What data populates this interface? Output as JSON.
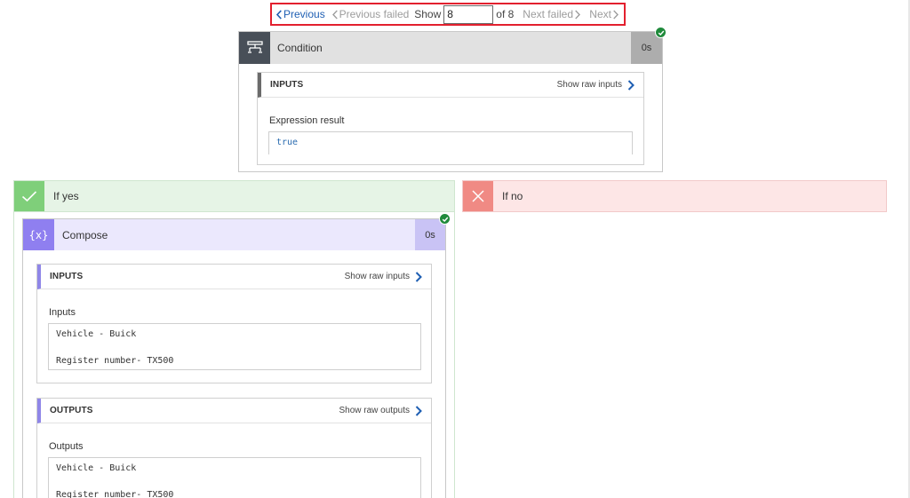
{
  "pager": {
    "previous_label": "Previous",
    "previous_failed_label": "Previous failed",
    "show_label": "Show",
    "current_value": "8",
    "of_label": "of 8",
    "next_failed_label": "Next failed",
    "next_label": "Next"
  },
  "condition": {
    "title": "Condition",
    "duration": "0s",
    "status": "succeeded",
    "inputs": {
      "header": "INPUTS",
      "raw_label": "Show raw inputs",
      "field_label": "Expression result",
      "field_value": "true"
    }
  },
  "branches": {
    "yes_label": "If yes",
    "no_label": "If no"
  },
  "compose": {
    "title": "Compose",
    "icon_text": "{x}",
    "duration": "0s",
    "status": "succeeded",
    "inputs": {
      "header": "INPUTS",
      "raw_label": "Show raw inputs",
      "field_label": "Inputs",
      "field_value": "Vehicle - Buick\n\nRegister number- TX500"
    },
    "outputs": {
      "header": "OUTPUTS",
      "raw_label": "Show raw outputs",
      "field_label": "Outputs",
      "field_value": "Vehicle - Buick\n\nRegister number- TX500"
    }
  },
  "colors": {
    "accent_blue": "#1f5fb3",
    "highlight_red": "#e3202e",
    "success_green": "#1f8a3b",
    "condition_icon_bg": "#484f58",
    "compose_icon_bg": "#8f7ff0",
    "yes_branch": "#7fcf7a",
    "no_branch": "#f08a84"
  },
  "icons": {
    "previous": "chevron-left-icon",
    "next": "chevron-right-icon",
    "condition": "condition-icon",
    "compose": "compose-icon",
    "success": "check-circle-icon",
    "yes": "checkmark-icon",
    "no": "close-icon"
  }
}
